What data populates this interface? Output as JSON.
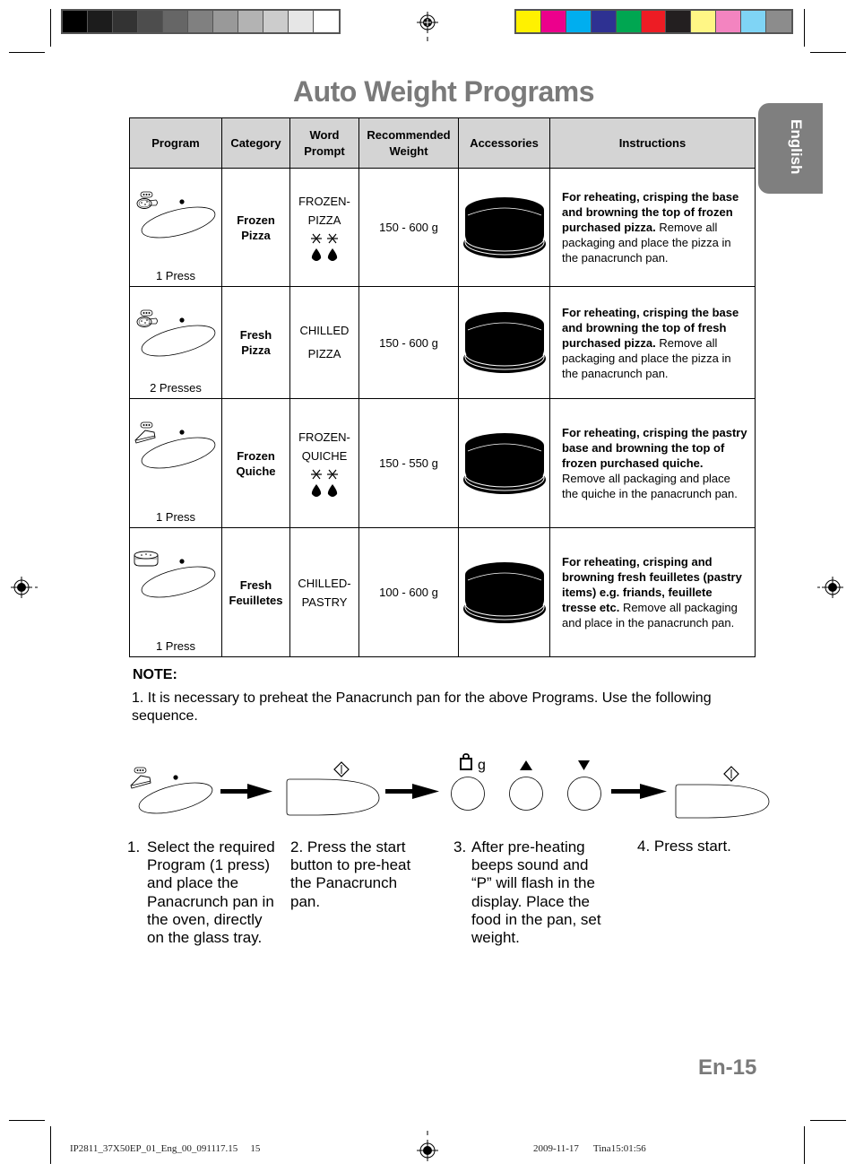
{
  "color_bars": {
    "grayscale": [
      "#000000",
      "#1c1c1c",
      "#333333",
      "#4d4d4d",
      "#666666",
      "#808080",
      "#999999",
      "#b3b3b3",
      "#cccccc",
      "#e6e6e6",
      "#ffffff"
    ],
    "process": [
      "#fff100",
      "#ec008c",
      "#00aeef",
      "#2e3192",
      "#00a651",
      "#ed1c24",
      "#231f20",
      "#fff685",
      "#f384c0",
      "#7fd4f5",
      "#8c8c8c"
    ]
  },
  "page": {
    "title": "Auto Weight Programs",
    "language_tab": "English",
    "page_number": "En-15",
    "title_color": "#7a7a7a"
  },
  "table": {
    "headers": [
      "Program",
      "Category",
      "Word Prompt",
      "Recommended Weight",
      "Accessories",
      "Instructions"
    ],
    "header_lines": {
      "word_prompt": [
        "Word",
        "Prompt"
      ],
      "recommended_weight": [
        "Recommended",
        "Weight"
      ]
    },
    "rows": [
      {
        "icon": "pizza-icon",
        "presses": "1 Press",
        "category": [
          "Frozen",
          "Pizza"
        ],
        "word_prompt": [
          "FROZEN-",
          "PIZZA"
        ],
        "frozen_symbol": true,
        "weight": "150 - 600 g",
        "accessory": "panacrunch-pan",
        "instructions_bold": "For reheating, crisping the base and browning the top of frozen purchased pizza.",
        "instructions_normal": " Remove all packaging and place the pizza in the panacrunch pan."
      },
      {
        "icon": "pizza-icon",
        "presses": "2 Presses",
        "category": [
          "Fresh",
          "Pizza"
        ],
        "word_prompt": [
          "CHILLED",
          "PIZZA"
        ],
        "frozen_symbol": false,
        "weight": "150 - 600 g",
        "accessory": "panacrunch-pan",
        "instructions_bold": "For reheating, crisping the base and browning the top of fresh purchased pizza.",
        "instructions_normal": " Remove all packaging and place the pizza in the panacrunch pan."
      },
      {
        "icon": "quiche-icon",
        "presses": "1 Press",
        "category": [
          "Frozen",
          "Quiche"
        ],
        "word_prompt": [
          "FROZEN-",
          "QUICHE"
        ],
        "frozen_symbol": true,
        "weight": "150 - 550 g",
        "accessory": "panacrunch-pan",
        "instructions_bold": "For reheating, crisping the pastry base and browning the top of frozen purchased quiche.",
        "instructions_normal": " Remove all packaging and place the quiche in the panacrunch pan."
      },
      {
        "icon": "feuillete-icon",
        "presses": "1 Press",
        "category": [
          "Fresh",
          "Feuilletes"
        ],
        "word_prompt": [
          "CHILLED-",
          "PASTRY"
        ],
        "frozen_symbol": false,
        "weight": "100 - 600 g",
        "accessory": "panacrunch-pan",
        "instructions_bold": "For reheating, crisping and browning fresh feuilletes (pastry items) e.g. friands, feuillete tresse etc.",
        "instructions_normal": " Remove all packaging and place in the panacrunch pan."
      }
    ]
  },
  "note": {
    "title": "NOTE:",
    "text": "1. It is necessary to preheat the Panacrunch pan for the above Programs. Use the following sequence."
  },
  "sequence": {
    "weight_label": "g",
    "steps": [
      {
        "num": "1.",
        "text": "Select the required Program (1 press) and place the Panacrunch pan in the oven, directly on the glass tray."
      },
      {
        "num": "2.",
        "text": "Press the start button to pre-heat the Panacrunch pan."
      },
      {
        "num": "3.",
        "text": "After pre-heating beeps sound and “P” will flash in the display. Place the food in the pan, set weight."
      },
      {
        "num": "4.",
        "text": "Press start."
      }
    ]
  },
  "footer": {
    "file": "IP2811_37X50EP_01_Eng_00_091117.15",
    "sheet": "15",
    "date": "2009-11-17",
    "time": "Tina15:01:56"
  }
}
